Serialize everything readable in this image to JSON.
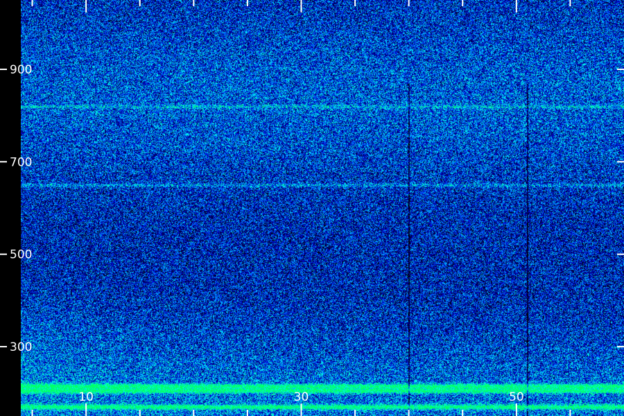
{
  "chart_data": {
    "type": "heatmap",
    "title": "",
    "xlabel": "",
    "ylabel": "",
    "x_range": [
      2,
      60
    ],
    "y_range": [
      150,
      1050
    ],
    "x_tick_labels": [
      "10",
      "30",
      "50"
    ],
    "x_label_values": [
      10,
      30,
      50
    ],
    "x_minor_tick_values": [
      5,
      10,
      15,
      20,
      25,
      30,
      35,
      40,
      45,
      50,
      55
    ],
    "y_tick_labels": [
      "900",
      "700",
      "500",
      "300"
    ],
    "y_tick_values": [
      900,
      700,
      500,
      300
    ],
    "colormap": [
      "#000000",
      "#000066",
      "#0000dd",
      "#0088ff",
      "#00ffee",
      "#00ff66"
    ],
    "bright_bands_y": [
      215,
      205,
      170,
      650,
      820
    ],
    "dark_columns_x": [
      40,
      51
    ],
    "grid": false,
    "legend": "none"
  },
  "colors": {
    "background": "#000000",
    "ticks": "#ffffff",
    "labels": "#ffffff"
  }
}
